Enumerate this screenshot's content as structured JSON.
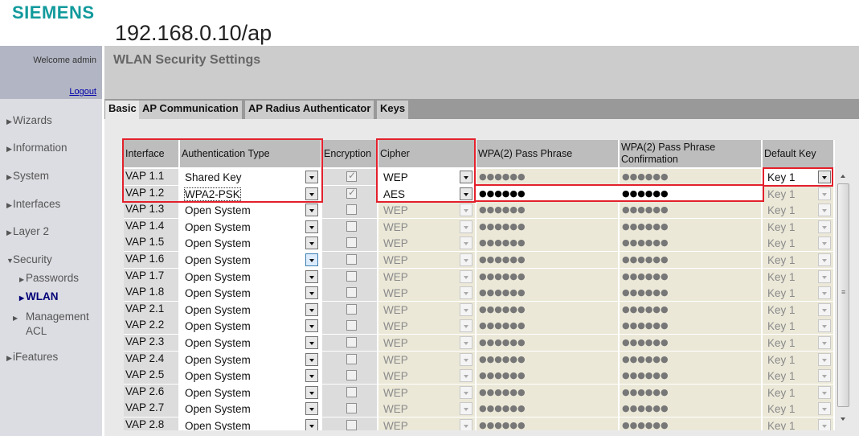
{
  "brand": {
    "logo": "SIEMENS",
    "host": "192.168.0.10/ap"
  },
  "sidebar": {
    "welcome": "Welcome admin",
    "logout": "Logout",
    "items": [
      {
        "label": "Wizards",
        "expanded": false
      },
      {
        "label": "Information",
        "expanded": false
      },
      {
        "label": "System",
        "expanded": false
      },
      {
        "label": "Interfaces",
        "expanded": false
      },
      {
        "label": "Layer 2",
        "expanded": false
      },
      {
        "label": "Security",
        "expanded": true
      },
      {
        "label": "iFeatures",
        "expanded": false
      }
    ],
    "security_sub": [
      {
        "label": "Passwords",
        "active": false
      },
      {
        "label": "WLAN",
        "active": true
      },
      {
        "label": "Management ACL",
        "active": false
      }
    ]
  },
  "page": {
    "title": "WLAN Security Settings",
    "tabs": [
      {
        "label": "Basic",
        "active": true
      },
      {
        "label": "AP Communication",
        "active": false
      },
      {
        "label": "AP Radius Authenticator",
        "active": false
      },
      {
        "label": "Keys",
        "active": false
      }
    ]
  },
  "table": {
    "headers": {
      "interface": "Interface",
      "auth": "Authentication Type",
      "encryption": "Encryption",
      "cipher": "Cipher",
      "passphrase": "WPA(2) Pass Phrase",
      "confirmation": "WPA(2) Pass Phrase Confirmation",
      "default_key": "Default Key"
    },
    "rows": [
      {
        "iface": "VAP 1.1",
        "auth": "Shared Key",
        "enc": true,
        "cipher": "WEP",
        "pp": "●●●●●●",
        "ppc": "●●●●●●",
        "key": "Key 1",
        "cipher_enabled": true,
        "pp_enabled": false,
        "key_enabled": true
      },
      {
        "iface": "VAP 1.2",
        "auth": "WPA2-PSK",
        "enc": true,
        "cipher": "AES",
        "pp": "●●●●●●",
        "ppc": "●●●●●●",
        "key": "Key 1",
        "cipher_enabled": true,
        "pp_enabled": true,
        "key_enabled": false,
        "focus": true
      },
      {
        "iface": "VAP 1.3",
        "auth": "Open System",
        "enc": false,
        "cipher": "WEP",
        "pp": "●●●●●●",
        "ppc": "●●●●●●",
        "key": "Key 1"
      },
      {
        "iface": "VAP 1.4",
        "auth": "Open System",
        "enc": false,
        "cipher": "WEP",
        "pp": "●●●●●●",
        "ppc": "●●●●●●",
        "key": "Key 1"
      },
      {
        "iface": "VAP 1.5",
        "auth": "Open System",
        "enc": false,
        "cipher": "WEP",
        "pp": "●●●●●●",
        "ppc": "●●●●●●",
        "key": "Key 1"
      },
      {
        "iface": "VAP 1.6",
        "auth": "Open System",
        "enc": false,
        "cipher": "WEP",
        "pp": "●●●●●●",
        "ppc": "●●●●●●",
        "key": "Key 1",
        "hover": true
      },
      {
        "iface": "VAP 1.7",
        "auth": "Open System",
        "enc": false,
        "cipher": "WEP",
        "pp": "●●●●●●",
        "ppc": "●●●●●●",
        "key": "Key 1"
      },
      {
        "iface": "VAP 1.8",
        "auth": "Open System",
        "enc": false,
        "cipher": "WEP",
        "pp": "●●●●●●",
        "ppc": "●●●●●●",
        "key": "Key 1"
      },
      {
        "iface": "VAP 2.1",
        "auth": "Open System",
        "enc": false,
        "cipher": "WEP",
        "pp": "●●●●●●",
        "ppc": "●●●●●●",
        "key": "Key 1"
      },
      {
        "iface": "VAP 2.2",
        "auth": "Open System",
        "enc": false,
        "cipher": "WEP",
        "pp": "●●●●●●",
        "ppc": "●●●●●●",
        "key": "Key 1"
      },
      {
        "iface": "VAP 2.3",
        "auth": "Open System",
        "enc": false,
        "cipher": "WEP",
        "pp": "●●●●●●",
        "ppc": "●●●●●●",
        "key": "Key 1"
      },
      {
        "iface": "VAP 2.4",
        "auth": "Open System",
        "enc": false,
        "cipher": "WEP",
        "pp": "●●●●●●",
        "ppc": "●●●●●●",
        "key": "Key 1"
      },
      {
        "iface": "VAP 2.5",
        "auth": "Open System",
        "enc": false,
        "cipher": "WEP",
        "pp": "●●●●●●",
        "ppc": "●●●●●●",
        "key": "Key 1"
      },
      {
        "iface": "VAP 2.6",
        "auth": "Open System",
        "enc": false,
        "cipher": "WEP",
        "pp": "●●●●●●",
        "ppc": "●●●●●●",
        "key": "Key 1"
      },
      {
        "iface": "VAP 2.7",
        "auth": "Open System",
        "enc": false,
        "cipher": "WEP",
        "pp": "●●●●●●",
        "ppc": "●●●●●●",
        "key": "Key 1"
      },
      {
        "iface": "VAP 2.8",
        "auth": "Open System",
        "enc": false,
        "cipher": "WEP",
        "pp": "●●●●●●",
        "ppc": "●●●●●●",
        "key": "Key 1"
      }
    ]
  },
  "annotation_color": "#e3202b"
}
